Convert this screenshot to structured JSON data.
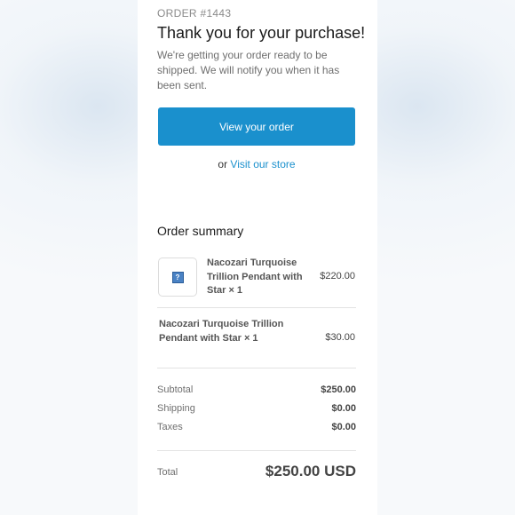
{
  "header": {
    "order_number": "ORDER #1443",
    "title": "Thank you for your purchase!",
    "message": "We're getting your order ready to be shipped. We will notify you when it has been sent."
  },
  "actions": {
    "view_order_label": "View your order",
    "or_text": "or",
    "visit_store_label": "Visit our store"
  },
  "summary": {
    "title": "Order summary",
    "items": [
      {
        "name": "Nacozari Turquoise Trillion Pendant with Star × 1",
        "price": "$220.00",
        "thumbnail_icon": "missing-image-icon"
      },
      {
        "name": "Nacozari Turquoise Trillion Pendant with Star × 1",
        "price": "$30.00"
      }
    ],
    "subtotal_label": "Subtotal",
    "subtotal_value": "$250.00",
    "shipping_label": "Shipping",
    "shipping_value": "$0.00",
    "taxes_label": "Taxes",
    "taxes_value": "$0.00",
    "total_label": "Total",
    "total_value": "$250.00 USD"
  },
  "colors": {
    "accent": "#1a90cd",
    "background": "#ffffff"
  }
}
